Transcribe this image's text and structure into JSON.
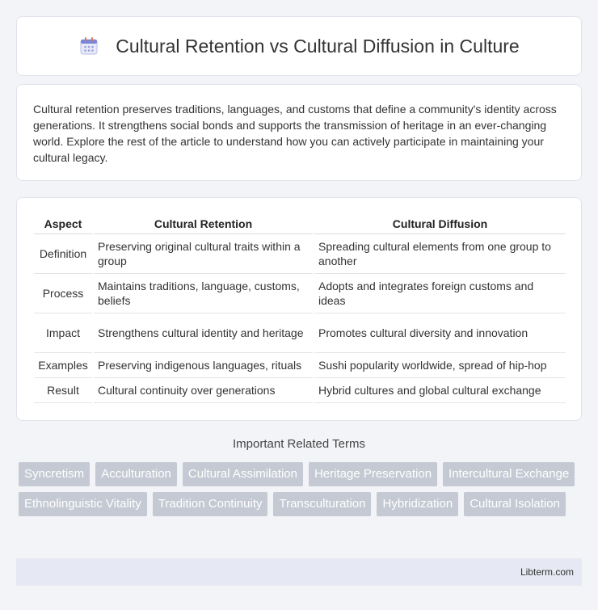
{
  "header": {
    "title": "Cultural Retention vs Cultural Diffusion in Culture",
    "icon": "calendar-icon"
  },
  "intro": {
    "text": "Cultural retention preserves traditions, languages, and customs that define a community's identity across generations. It strengthens social bonds and supports the transmission of heritage in an ever-changing world. Explore the rest of the article to understand how you can actively participate in maintaining your cultural legacy."
  },
  "table": {
    "headers": [
      "Aspect",
      "Cultural Retention",
      "Cultural Diffusion"
    ],
    "rows": [
      [
        "Definition",
        "Preserving original cultural traits within a group",
        "Spreading cultural elements from one group to another"
      ],
      [
        "Process",
        "Maintains traditions, language, customs, beliefs",
        "Adopts and integrates foreign customs and ideas"
      ],
      [
        "Impact",
        "Strengthens cultural identity and heritage",
        "Promotes cultural diversity and innovation"
      ],
      [
        "Examples",
        "Preserving indigenous languages, rituals",
        "Sushi popularity worldwide, spread of hip-hop"
      ],
      [
        "Result",
        "Cultural continuity over generations",
        "Hybrid cultures and global cultural exchange"
      ]
    ]
  },
  "related": {
    "title": "Important Related Terms",
    "terms": [
      "Syncretism",
      "Acculturation",
      "Cultural Assimilation",
      "Heritage Preservation",
      "Intercultural Exchange",
      "Ethnolinguistic Vitality",
      "Tradition Continuity",
      "Transculturation",
      "Hybridization",
      "Cultural Isolation"
    ]
  },
  "footer": {
    "text": "Libterm.com"
  },
  "colors": {
    "tag_bg": "#c4c9d3",
    "footer_bg": "#e6e9f3",
    "page_bg": "#f3f4f8"
  }
}
